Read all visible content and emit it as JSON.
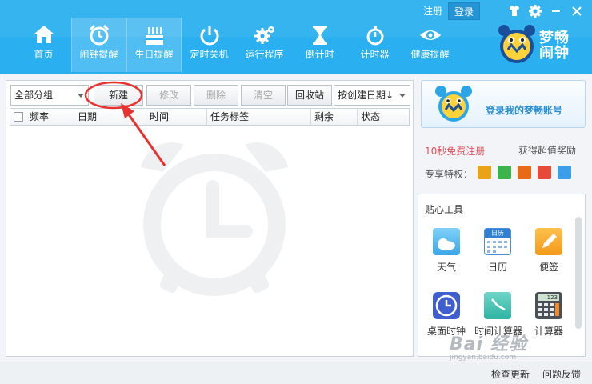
{
  "app": {
    "brand_line1": "梦畅",
    "brand_line2": "闹钟"
  },
  "top_links": {
    "register": "注册",
    "login": "登录"
  },
  "nav": [
    {
      "label": "首页",
      "icon": "home-icon"
    },
    {
      "label": "闹钟提醒",
      "icon": "alarm-clock-icon"
    },
    {
      "label": "生日提醒",
      "icon": "birthday-cake-icon"
    },
    {
      "label": "定时关机",
      "icon": "power-icon"
    },
    {
      "label": "运行程序",
      "icon": "gears-icon"
    },
    {
      "label": "倒计时",
      "icon": "hourglass-icon"
    },
    {
      "label": "计时器",
      "icon": "stopwatch-icon"
    },
    {
      "label": "健康提醒",
      "icon": "eye-icon"
    }
  ],
  "toolbar": {
    "group_select": "全部分组",
    "new": "新建",
    "edit": "修改",
    "delete": "删除",
    "clear": "清空",
    "recycle": "回收站",
    "sort_select": "按创建日期↓"
  },
  "table": {
    "columns": [
      "频率",
      "日期",
      "时间",
      "任务标签",
      "剩余",
      "状态"
    ],
    "rows": []
  },
  "account": {
    "login_prompt": "登录我的梦畅账号",
    "register_free": "10秒免费注册",
    "reward": "获得超值奖励",
    "privileges_label": "专享特权："
  },
  "tools": {
    "heading": "贴心工具",
    "items": [
      {
        "label": "天气",
        "icon": "weather-icon"
      },
      {
        "label": "日历",
        "icon": "calendar-icon",
        "badge": "日历"
      },
      {
        "label": "便签",
        "icon": "note-pencil-icon"
      },
      {
        "label": "桌面时钟",
        "icon": "desktop-clock-icon"
      },
      {
        "label": "时间计算器",
        "icon": "time-calculator-icon"
      },
      {
        "label": "计算器",
        "icon": "calculator-icon",
        "display": "123"
      }
    ]
  },
  "status": {
    "check_update": "检查更新",
    "feedback": "问题反馈"
  },
  "watermark": {
    "main": "Bai 经验",
    "sub": "jingyan.baidu.com"
  },
  "colors": {
    "header_bg": "#2ab0f0",
    "annotation_red": "#e8322f",
    "link_blue": "#2b8ed0",
    "register_red": "#e2505a"
  }
}
